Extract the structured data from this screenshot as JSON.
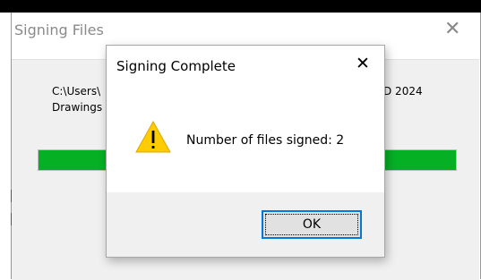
{
  "background_window": {
    "title": "Signing Files",
    "path_line_1": "C:\\Users\\",
    "path_line_2": "Drawings",
    "path_suffix": "D 2024",
    "progress_fraction": 1.0,
    "progress_color": "#06b025",
    "close_icon": "close-icon"
  },
  "dialog": {
    "title": "Signing Complete",
    "message": "Number of files signed: 2",
    "ok_label": "OK",
    "icon": "warning-icon",
    "close_icon": "close-icon"
  }
}
